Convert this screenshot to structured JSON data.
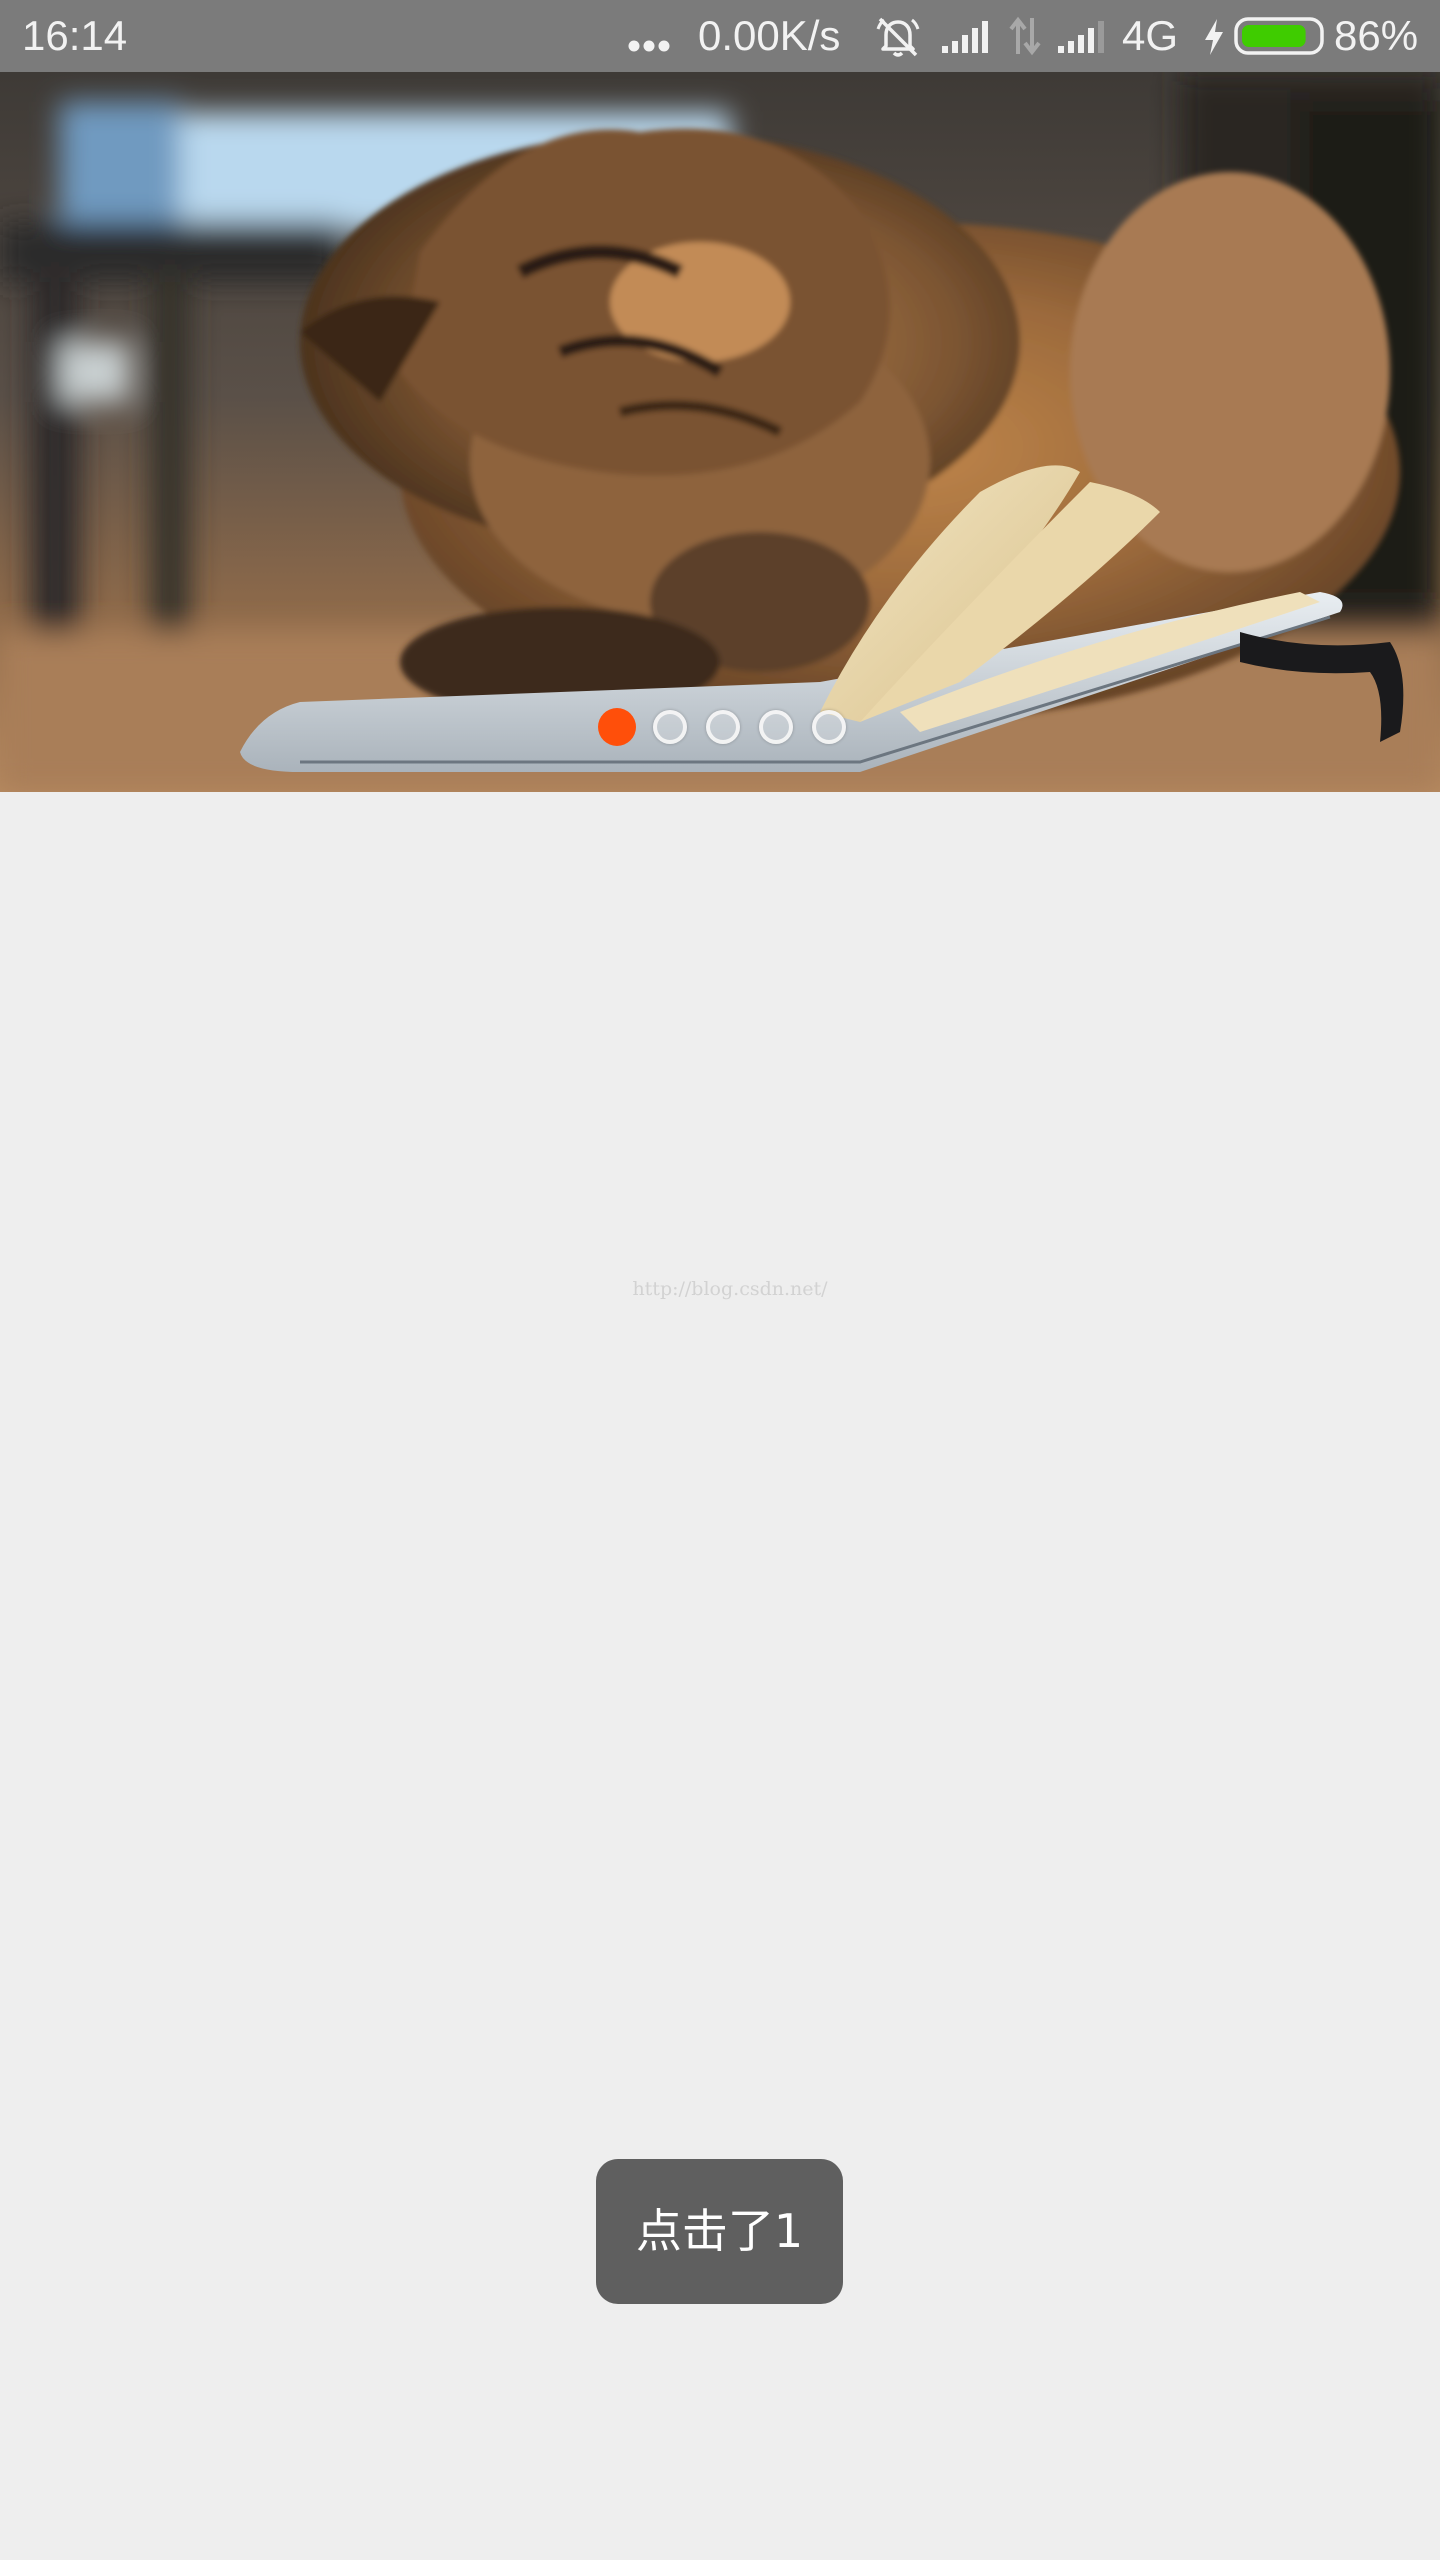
{
  "status_bar": {
    "time": "16:14",
    "network_speed": "0.00K/s",
    "network_type": "4G",
    "battery_percent": "86%",
    "battery_level": 0.86,
    "battery_color": "#3fcc00",
    "icons": [
      "more-dots-icon",
      "alarm-off-icon",
      "signal-icon",
      "data-arrows-icon",
      "signal-icon",
      "charging-icon",
      "battery-icon"
    ]
  },
  "banner": {
    "image": "cat-reading-book-photo",
    "slide_count": 5,
    "active_slide": 1,
    "indicator_active_color": "#ff4f0a"
  },
  "watermark": {
    "text": "http://blog.csdn.net/"
  },
  "toast": {
    "text": "点击了1"
  }
}
